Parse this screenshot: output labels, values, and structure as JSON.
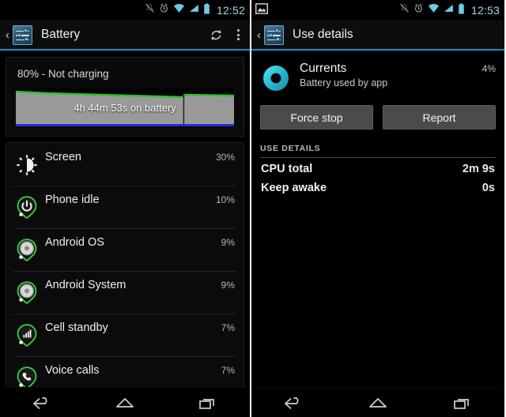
{
  "colors": {
    "accent_blue": "#4a90c2",
    "status_cyan": "#6fc8e8",
    "graph_green": "#2fbf2f",
    "graph_fill": "#9a9a9a",
    "graph_blue": "#1f2fd8",
    "button_gray": "#4b4b4b",
    "track_gray": "#2c2c2c",
    "actionbar_rule": "#1a8fc1"
  },
  "left_panel": {
    "status_bar": {
      "time": "12:52",
      "icons": [
        "vibrate-off-icon",
        "alarm-clock-icon",
        "wifi-icon",
        "cell-signal-icon",
        "battery-icon"
      ]
    },
    "action_bar": {
      "back_glyph": "‹",
      "app_icon": "settings-sliders-icon",
      "title": "Battery",
      "actions": [
        "refresh-icon",
        "overflow-menu-icon"
      ]
    },
    "summary": {
      "status_text": "80% - Not charging",
      "graph_label": "4h 44m 53s on battery",
      "battery_percent": 80
    },
    "usage_list": [
      {
        "name": "Screen",
        "percent": "30%",
        "bar_fill": 100,
        "icon": "brightness-icon"
      },
      {
        "name": "Phone idle",
        "percent": "10%",
        "bar_fill": 33,
        "icon": "power-pin-icon"
      },
      {
        "name": "Android OS",
        "percent": "9%",
        "bar_fill": 31,
        "icon": "android-os-pin-icon"
      },
      {
        "name": "Android System",
        "percent": "9%",
        "bar_fill": 31,
        "icon": "android-system-pin-icon"
      },
      {
        "name": "Cell standby",
        "percent": "7%",
        "bar_fill": 24,
        "icon": "signal-bars-pin-icon"
      },
      {
        "name": "Voice calls",
        "percent": "7%",
        "bar_fill": 24,
        "icon": "phone-handset-pin-icon"
      }
    ]
  },
  "right_panel": {
    "status_bar": {
      "time": "12:53",
      "left_icons": [
        "screenshot-image-icon"
      ],
      "icons": [
        "vibrate-off-icon",
        "alarm-clock-icon",
        "wifi-icon",
        "cell-signal-icon",
        "battery-icon"
      ]
    },
    "action_bar": {
      "back_glyph": "‹",
      "app_icon": "settings-sliders-icon",
      "title": "Use details"
    },
    "app": {
      "name": "Currents",
      "percent": "4%",
      "bar_fill": 13,
      "caption": "Battery used by app",
      "icon": "currents-ring-icon"
    },
    "buttons": {
      "force_stop": "Force stop",
      "report": "Report"
    },
    "use_details": {
      "section_title": "USE DETAILS",
      "rows": [
        {
          "key": "CPU total",
          "value": "2m 9s"
        },
        {
          "key": "Keep awake",
          "value": "0s"
        }
      ]
    }
  },
  "nav_bar": {
    "buttons": [
      "back-nav-icon",
      "home-nav-icon",
      "recents-nav-icon"
    ]
  }
}
